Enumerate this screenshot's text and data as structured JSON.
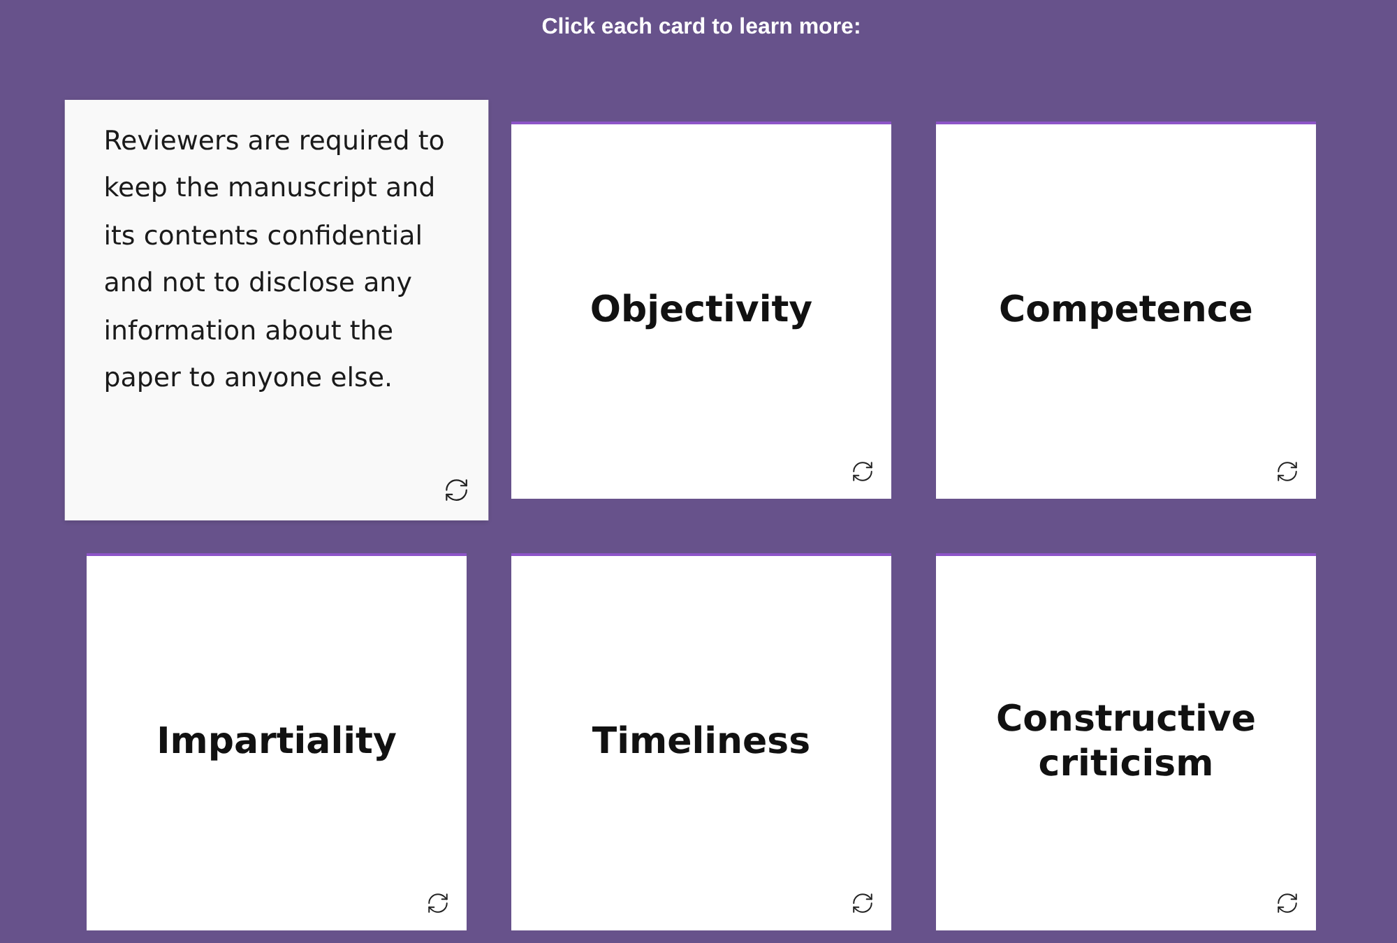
{
  "heading": "Click each card to learn more:",
  "cards": [
    {
      "text": "Reviewers are required to keep the manuscript and its contents confidential and not to disclose any information about the paper to anyone else.",
      "flipped": true
    },
    {
      "text": "Objectivity",
      "flipped": false
    },
    {
      "text": "Competence",
      "flipped": false
    },
    {
      "text": "Impartiality",
      "flipped": false
    },
    {
      "text": "Timeliness",
      "flipped": false
    },
    {
      "text": "Constructive criticism",
      "flipped": false
    }
  ]
}
